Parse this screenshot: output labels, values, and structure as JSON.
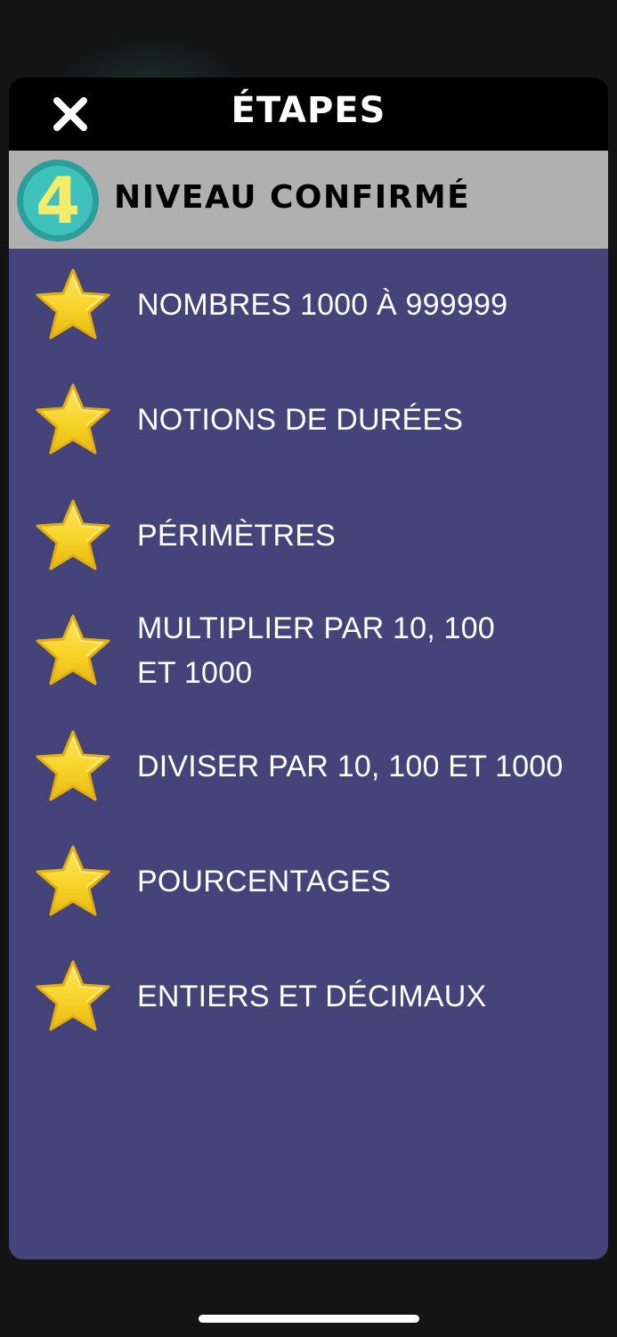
{
  "header": {
    "title": "ÉTAPES",
    "close_icon": "close-icon"
  },
  "level": {
    "number": "4",
    "title": "NIVEAU CONFIRMÉ",
    "badge_color": "#3ec2bb",
    "number_color": "#f6ec6c"
  },
  "steps": [
    {
      "label": "NOMBRES 1000 À 999999",
      "icon": "star-icon"
    },
    {
      "label": "NOTIONS DE DURÉES",
      "icon": "star-icon"
    },
    {
      "label": "PÉRIMÈTRES",
      "icon": "star-icon"
    },
    {
      "label": "MULTIPLIER PAR 10, 100\nET 1000",
      "icon": "star-icon"
    },
    {
      "label": "DIVISER PAR 10, 100 ET 1000",
      "icon": "star-icon"
    },
    {
      "label": "POURCENTAGES",
      "icon": "star-icon"
    },
    {
      "label": "ENTIERS ET DÉCIMAUX",
      "icon": "star-icon"
    }
  ],
  "colors": {
    "panel_background": "#44447a",
    "header_background": "#000000",
    "level_band": "#b0b0b0",
    "star": "#f5d020"
  }
}
